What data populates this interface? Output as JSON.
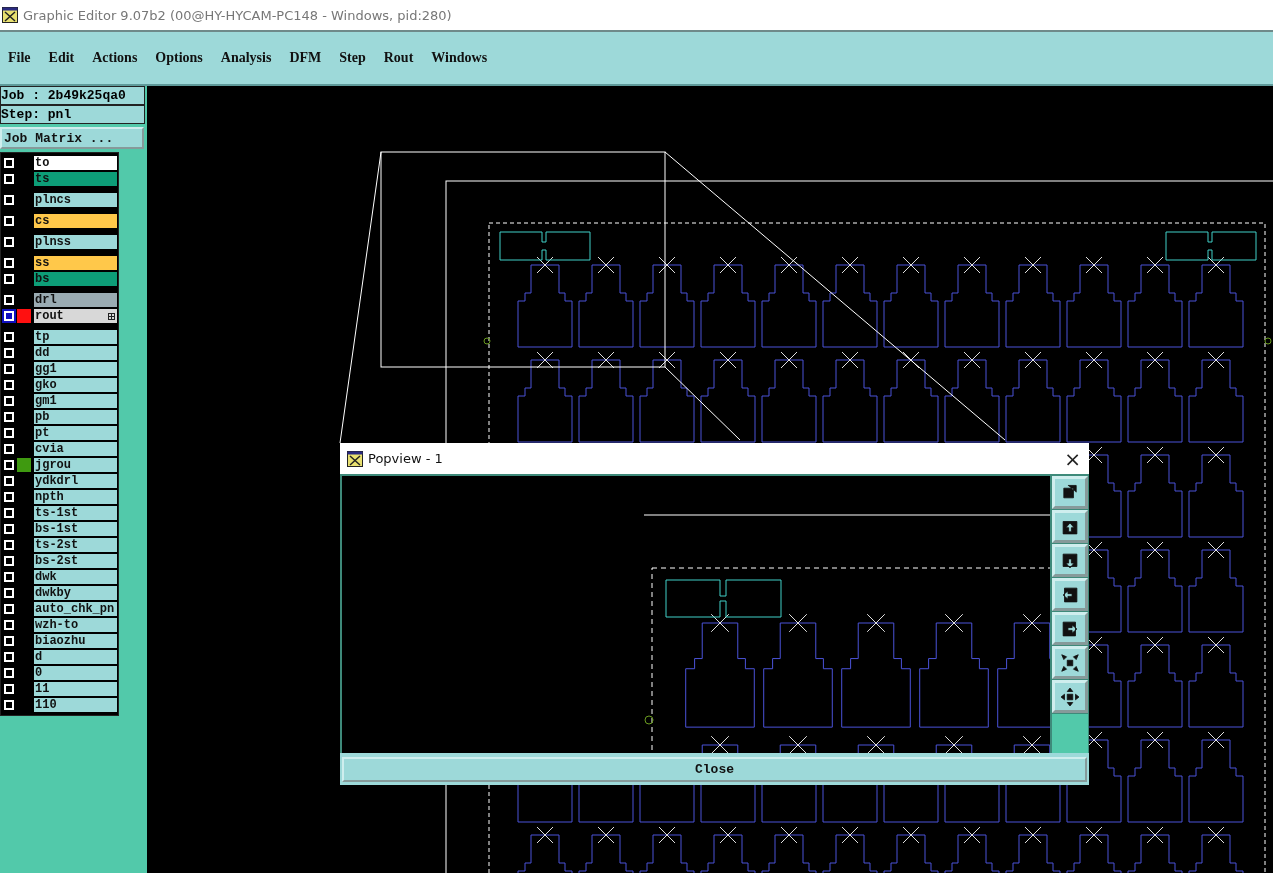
{
  "window": {
    "title": "Graphic Editor 9.07b2 (00@HY-HYCAM-PC148 - Windows, pid:280)"
  },
  "menu": [
    "File",
    "Edit",
    "Actions",
    "Options",
    "Analysis",
    "DFM",
    "Step",
    "Rout",
    "Windows"
  ],
  "job": "Job : 2b49k25qa0",
  "step": "Step: pnl",
  "job_matrix_button": "Job Matrix ...",
  "layer_groups": [
    {
      "layers": [
        {
          "name": "to",
          "kind": "paste",
          "checked": false,
          "work": false,
          "expandable": false
        },
        {
          "name": "ts",
          "kind": "mask",
          "checked": false,
          "work": false,
          "expandable": false
        }
      ]
    },
    {
      "layers": [
        {
          "name": "plncs",
          "kind": "document",
          "checked": false,
          "work": false,
          "expandable": false
        }
      ]
    },
    {
      "layers": [
        {
          "name": "cs",
          "kind": "signal",
          "checked": false,
          "work": false,
          "expandable": false
        }
      ]
    },
    {
      "layers": [
        {
          "name": "plnss",
          "kind": "document",
          "checked": false,
          "work": false,
          "expandable": false
        }
      ]
    },
    {
      "layers": [
        {
          "name": "ss",
          "kind": "signal",
          "checked": false,
          "work": false,
          "expandable": false
        },
        {
          "name": "bs",
          "kind": "mask",
          "checked": false,
          "work": false,
          "expandable": false
        }
      ]
    },
    {
      "layers": [
        {
          "name": "drl",
          "kind": "drill",
          "checked": false,
          "work": false,
          "expandable": false
        },
        {
          "name": "rout",
          "kind": "rout",
          "checked": false,
          "work": true,
          "color": "#ff1010",
          "expandable": true
        }
      ]
    },
    {
      "layers": [
        {
          "name": "tp",
          "kind": "document",
          "checked": false,
          "work": false,
          "expandable": false
        },
        {
          "name": "dd",
          "kind": "document",
          "checked": false,
          "work": false,
          "expandable": false
        },
        {
          "name": "gg1",
          "kind": "document",
          "checked": false,
          "work": false,
          "expandable": false
        },
        {
          "name": "gko",
          "kind": "document",
          "checked": false,
          "work": false,
          "expandable": false
        },
        {
          "name": "gm1",
          "kind": "document",
          "checked": false,
          "work": false,
          "expandable": false
        },
        {
          "name": "pb",
          "kind": "document",
          "checked": false,
          "work": false,
          "expandable": false
        },
        {
          "name": "pt",
          "kind": "document",
          "checked": false,
          "work": false,
          "expandable": false
        },
        {
          "name": "cvia",
          "kind": "document",
          "checked": false,
          "work": false,
          "expandable": false
        },
        {
          "name": "jgrou",
          "kind": "document",
          "checked": false,
          "work": false,
          "color": "#3f9a10",
          "expandable": false
        },
        {
          "name": "ydkdrl",
          "kind": "document",
          "checked": false,
          "work": false,
          "expandable": false
        },
        {
          "name": "npth",
          "kind": "document",
          "checked": false,
          "work": false,
          "expandable": false
        },
        {
          "name": "ts-1st",
          "kind": "document",
          "checked": false,
          "work": false,
          "expandable": false
        },
        {
          "name": "bs-1st",
          "kind": "document",
          "checked": false,
          "work": false,
          "expandable": false
        },
        {
          "name": "ts-2st",
          "kind": "document",
          "checked": false,
          "work": false,
          "expandable": false
        },
        {
          "name": "bs-2st",
          "kind": "document",
          "checked": false,
          "work": false,
          "expandable": false
        },
        {
          "name": "dwk",
          "kind": "document",
          "checked": false,
          "work": false,
          "expandable": false
        },
        {
          "name": "dwkby",
          "kind": "document",
          "checked": false,
          "work": false,
          "expandable": false
        },
        {
          "name": "auto_chk_pn",
          "kind": "document",
          "checked": false,
          "work": false,
          "expandable": false
        },
        {
          "name": "wzh-to",
          "kind": "document",
          "checked": false,
          "work": false,
          "expandable": false
        },
        {
          "name": "biaozhu",
          "kind": "document",
          "checked": false,
          "work": false,
          "expandable": false
        },
        {
          "name": "d",
          "kind": "document",
          "checked": false,
          "work": false,
          "expandable": false
        },
        {
          "name": "0",
          "kind": "document",
          "checked": false,
          "work": false,
          "expandable": false
        },
        {
          "name": "11",
          "kind": "document",
          "checked": false,
          "work": false,
          "expandable": false
        },
        {
          "name": "110",
          "kind": "document",
          "checked": false,
          "work": false,
          "expandable": false
        }
      ]
    }
  ],
  "popview": {
    "title": "Popview - 1",
    "close_glyph": "×",
    "toolbar": [
      {
        "kind": "restore"
      },
      {
        "kind": "up"
      },
      {
        "kind": "down"
      },
      {
        "kind": "left"
      },
      {
        "kind": "right"
      },
      {
        "kind": "zoom_in"
      },
      {
        "kind": "zoom_out"
      }
    ],
    "close_button": "Close"
  }
}
